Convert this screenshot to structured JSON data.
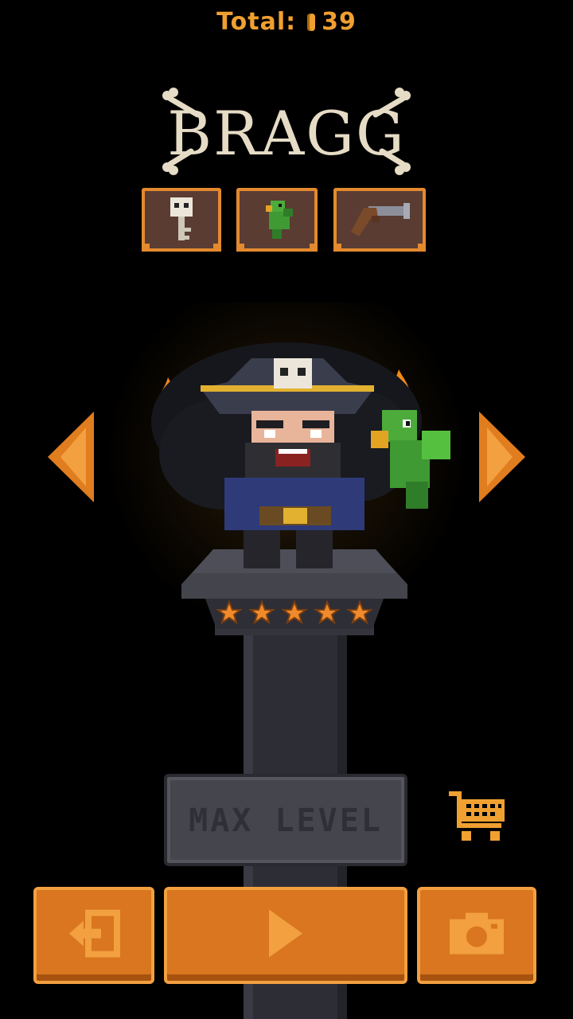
{
  "header": {
    "total_label": "Total:",
    "coins": "39"
  },
  "character": {
    "name": "BRAGG",
    "stars": 5
  },
  "equipment": [
    {
      "name": "skull-key"
    },
    {
      "name": "parrot"
    },
    {
      "name": "flintlock-pistol"
    }
  ],
  "upgrade": {
    "label": "MAX LEVEL"
  },
  "colors": {
    "accent": "#d9761f",
    "accent_light": "#f2a040",
    "gold": "#f0a030",
    "title": "#e6dcc6"
  }
}
